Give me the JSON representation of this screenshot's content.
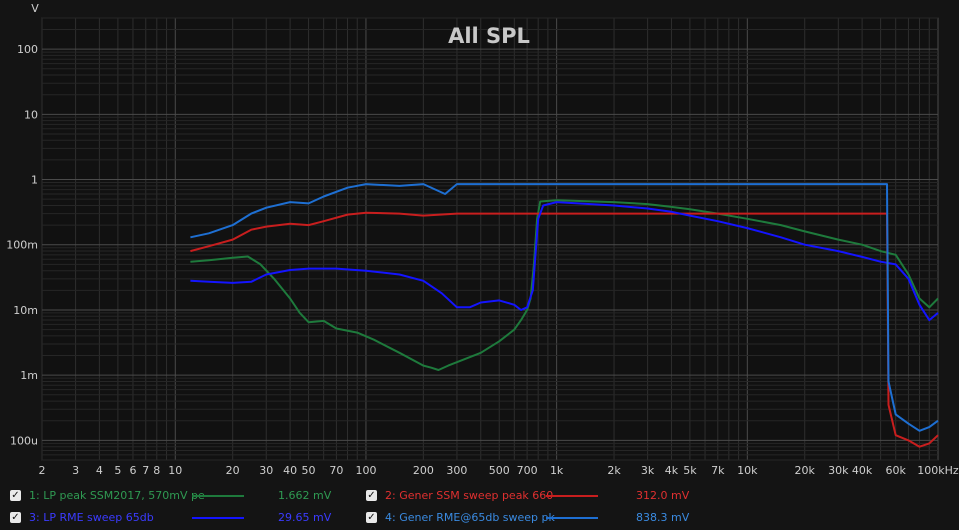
{
  "chart_data": {
    "type": "line",
    "title": "All SPL",
    "ylabel": "V",
    "xlabel": "",
    "x_unit": "Hz",
    "x_scale": "log",
    "y_scale": "log",
    "xlim": [
      2,
      100000
    ],
    "ylim": [
      5e-05,
      300
    ],
    "grid": true,
    "x_ticks": [
      {
        "v": 2,
        "label": "2"
      },
      {
        "v": 3,
        "label": "3"
      },
      {
        "v": 4,
        "label": "4"
      },
      {
        "v": 5,
        "label": "5"
      },
      {
        "v": 6,
        "label": "6"
      },
      {
        "v": 7,
        "label": "7"
      },
      {
        "v": 8,
        "label": "8"
      },
      {
        "v": 10,
        "label": "10"
      },
      {
        "v": 20,
        "label": "20"
      },
      {
        "v": 30,
        "label": "30"
      },
      {
        "v": 40,
        "label": "40"
      },
      {
        "v": 50,
        "label": "50"
      },
      {
        "v": 70,
        "label": "70"
      },
      {
        "v": 100,
        "label": "100"
      },
      {
        "v": 200,
        "label": "200"
      },
      {
        "v": 300,
        "label": "300"
      },
      {
        "v": 500,
        "label": "500"
      },
      {
        "v": 700,
        "label": "700"
      },
      {
        "v": 1000,
        "label": "1k"
      },
      {
        "v": 2000,
        "label": "2k"
      },
      {
        "v": 3000,
        "label": "3k"
      },
      {
        "v": 4000,
        "label": "4k"
      },
      {
        "v": 5000,
        "label": "5k"
      },
      {
        "v": 7000,
        "label": "7k"
      },
      {
        "v": 10000,
        "label": "10k"
      },
      {
        "v": 20000,
        "label": "20k"
      },
      {
        "v": 30000,
        "label": "30k"
      },
      {
        "v": 40000,
        "label": "40k"
      },
      {
        "v": 60000,
        "label": "60k"
      },
      {
        "v": 100000,
        "label": "100kHz"
      }
    ],
    "y_ticks": [
      {
        "v": 100,
        "label": "100"
      },
      {
        "v": 10,
        "label": "10"
      },
      {
        "v": 1,
        "label": "1"
      },
      {
        "v": 0.1,
        "label": "100m"
      },
      {
        "v": 0.01,
        "label": "10m"
      },
      {
        "v": 0.001,
        "label": "1m"
      },
      {
        "v": 0.0001,
        "label": "100u"
      }
    ],
    "series": [
      {
        "name": "1: LP peak SSM2017, 570mV pe",
        "color": "#1e7a3c",
        "value_label": "1.662 mV",
        "points": [
          [
            12,
            0.055
          ],
          [
            15,
            0.058
          ],
          [
            20,
            0.063
          ],
          [
            24,
            0.066
          ],
          [
            28,
            0.05
          ],
          [
            33,
            0.03
          ],
          [
            40,
            0.015
          ],
          [
            45,
            0.009
          ],
          [
            50,
            0.0065
          ],
          [
            60,
            0.0068
          ],
          [
            70,
            0.0052
          ],
          [
            90,
            0.0045
          ],
          [
            110,
            0.0035
          ],
          [
            150,
            0.0022
          ],
          [
            200,
            0.0014
          ],
          [
            220,
            0.0013
          ],
          [
            240,
            0.0012
          ],
          [
            270,
            0.0014
          ],
          [
            320,
            0.0017
          ],
          [
            400,
            0.0022
          ],
          [
            500,
            0.0033
          ],
          [
            600,
            0.005
          ],
          [
            650,
            0.007
          ],
          [
            700,
            0.01
          ],
          [
            730,
            0.015
          ],
          [
            760,
            0.05
          ],
          [
            790,
            0.25
          ],
          [
            820,
            0.46
          ],
          [
            1000,
            0.48
          ],
          [
            2000,
            0.45
          ],
          [
            3000,
            0.42
          ],
          [
            4000,
            0.38
          ],
          [
            5000,
            0.35
          ],
          [
            7000,
            0.3
          ],
          [
            10000,
            0.25
          ],
          [
            15000,
            0.2
          ],
          [
            20000,
            0.16
          ],
          [
            30000,
            0.12
          ],
          [
            40000,
            0.1
          ],
          [
            50000,
            0.08
          ],
          [
            60000,
            0.07
          ],
          [
            70000,
            0.035
          ],
          [
            80000,
            0.015
          ],
          [
            90000,
            0.011
          ],
          [
            100000,
            0.015
          ]
        ]
      },
      {
        "name": "2: Gener SSM sweep peak 660",
        "color": "#c81e1e",
        "value_label": "312.0 mV",
        "points": [
          [
            12,
            0.08
          ],
          [
            15,
            0.095
          ],
          [
            20,
            0.12
          ],
          [
            25,
            0.17
          ],
          [
            30,
            0.19
          ],
          [
            40,
            0.21
          ],
          [
            50,
            0.2
          ],
          [
            60,
            0.23
          ],
          [
            80,
            0.29
          ],
          [
            100,
            0.31
          ],
          [
            150,
            0.3
          ],
          [
            200,
            0.28
          ],
          [
            300,
            0.3
          ],
          [
            500,
            0.3
          ],
          [
            800,
            0.3
          ],
          [
            1000,
            0.3
          ],
          [
            2000,
            0.3
          ],
          [
            5000,
            0.3
          ],
          [
            10000,
            0.3
          ],
          [
            20000,
            0.3
          ],
          [
            30000,
            0.3
          ],
          [
            50000,
            0.3
          ],
          [
            54000,
            0.3
          ],
          [
            55000,
            0.00035
          ],
          [
            60000,
            0.00012
          ],
          [
            70000,
            0.0001
          ],
          [
            80000,
            8e-05
          ],
          [
            90000,
            9e-05
          ],
          [
            100000,
            0.00012
          ]
        ]
      },
      {
        "name": "3: LP RME sweep 65db",
        "color": "#1414ff",
        "value_label": "29.65 mV",
        "points": [
          [
            12,
            0.028
          ],
          [
            15,
            0.027
          ],
          [
            20,
            0.026
          ],
          [
            25,
            0.027
          ],
          [
            30,
            0.035
          ],
          [
            40,
            0.041
          ],
          [
            50,
            0.043
          ],
          [
            70,
            0.043
          ],
          [
            100,
            0.04
          ],
          [
            150,
            0.035
          ],
          [
            200,
            0.028
          ],
          [
            250,
            0.018
          ],
          [
            300,
            0.011
          ],
          [
            350,
            0.011
          ],
          [
            400,
            0.013
          ],
          [
            500,
            0.014
          ],
          [
            600,
            0.012
          ],
          [
            650,
            0.01
          ],
          [
            700,
            0.011
          ],
          [
            750,
            0.02
          ],
          [
            800,
            0.25
          ],
          [
            850,
            0.4
          ],
          [
            1000,
            0.45
          ],
          [
            2000,
            0.4
          ],
          [
            3000,
            0.36
          ],
          [
            4000,
            0.32
          ],
          [
            5000,
            0.28
          ],
          [
            7000,
            0.23
          ],
          [
            10000,
            0.18
          ],
          [
            15000,
            0.13
          ],
          [
            20000,
            0.1
          ],
          [
            30000,
            0.08
          ],
          [
            40000,
            0.065
          ],
          [
            50000,
            0.055
          ],
          [
            60000,
            0.05
          ],
          [
            70000,
            0.03
          ],
          [
            80000,
            0.012
          ],
          [
            90000,
            0.007
          ],
          [
            100000,
            0.009
          ]
        ]
      },
      {
        "name": "4: Gener RME@65db sweep pk",
        "color": "#1e6fd2",
        "value_label": "838.3 mV",
        "points": [
          [
            12,
            0.13
          ],
          [
            15,
            0.15
          ],
          [
            20,
            0.2
          ],
          [
            25,
            0.3
          ],
          [
            30,
            0.37
          ],
          [
            40,
            0.45
          ],
          [
            50,
            0.43
          ],
          [
            60,
            0.55
          ],
          [
            80,
            0.75
          ],
          [
            100,
            0.85
          ],
          [
            150,
            0.8
          ],
          [
            200,
            0.85
          ],
          [
            260,
            0.6
          ],
          [
            300,
            0.85
          ],
          [
            500,
            0.85
          ],
          [
            1000,
            0.85
          ],
          [
            2000,
            0.85
          ],
          [
            5000,
            0.85
          ],
          [
            10000,
            0.85
          ],
          [
            20000,
            0.85
          ],
          [
            50000,
            0.85
          ],
          [
            54000,
            0.85
          ],
          [
            55000,
            0.0008
          ],
          [
            60000,
            0.00025
          ],
          [
            70000,
            0.00018
          ],
          [
            80000,
            0.00014
          ],
          [
            90000,
            0.00016
          ],
          [
            100000,
            0.0002
          ]
        ]
      }
    ]
  }
}
